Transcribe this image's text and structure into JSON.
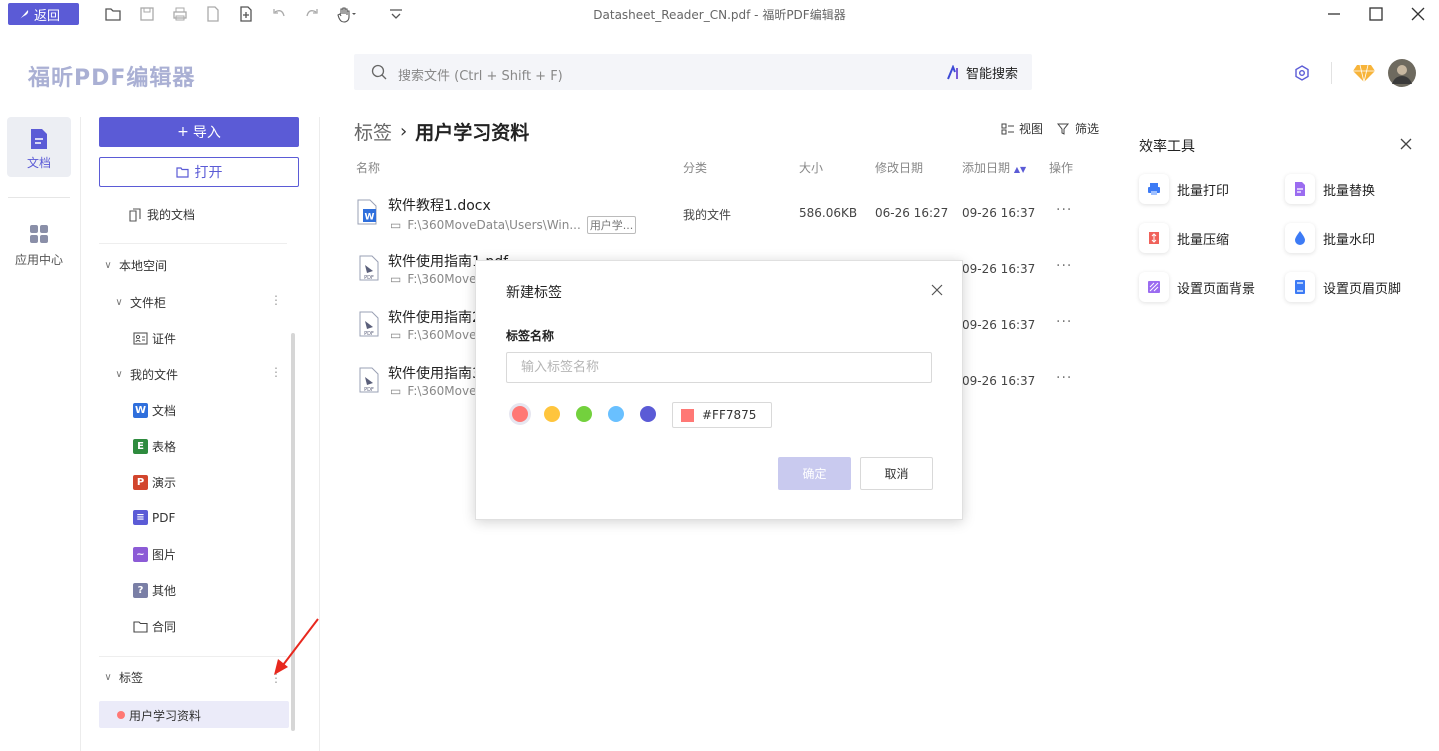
{
  "titlebar": {
    "back_label": "返回",
    "window_title": "Datasheet_Reader_CN.pdf - 福昕PDF编辑器",
    "toolbar_icons": [
      "open-folder-icon",
      "save-icon",
      "print-icon",
      "page-icon",
      "new-file-icon",
      "undo-icon",
      "redo-icon",
      "hand-tool-icon",
      "dropdown-icon"
    ]
  },
  "header": {
    "logo": "福昕PDF编辑器",
    "search_placeholder": "搜索文件 (Ctrl + Shift + F)",
    "ai_search_label": "智能搜索"
  },
  "rail": {
    "documents_label": "文档",
    "apps_label": "应用中心"
  },
  "sidebar": {
    "import_label": "导入",
    "open_label": "打开",
    "my_docs_label": "我的文档",
    "local_space_label": "本地空间",
    "cabinet_label": "文件柜",
    "certificate_label": "证件",
    "my_files_label": "我的文件",
    "file_types": [
      {
        "label": "文档",
        "color": "#2f6fdc",
        "glyph": "W"
      },
      {
        "label": "表格",
        "color": "#2e8b3e",
        "glyph": "E"
      },
      {
        "label": "演示",
        "color": "#d2452d",
        "glyph": "P"
      },
      {
        "label": "PDF",
        "color": "#5b5bd6",
        "glyph": "≡"
      },
      {
        "label": "图片",
        "color": "#8c5bd6",
        "glyph": "~"
      },
      {
        "label": "其他",
        "color": "#7a7fa6",
        "glyph": "?"
      },
      {
        "label": "合同",
        "color": "",
        "glyph": ""
      }
    ],
    "tags_label": "标签",
    "tag_items": [
      {
        "label": "用户学习资料",
        "color": "#FF7875"
      }
    ]
  },
  "main": {
    "breadcrumb_root": "标签",
    "breadcrumb_current": "用户学习资料",
    "view_label": "视图",
    "filter_label": "筛选",
    "columns": [
      "名称",
      "分类",
      "大小",
      "修改日期",
      "添加日期",
      "操作"
    ],
    "rows": [
      {
        "name": "软件教程1.docx",
        "path": "F:\\360MoveData\\Users\\Win...",
        "tag": "用户学...",
        "category": "我的文件",
        "size": "586.06KB",
        "modified": "06-26 16:27",
        "added": "09-26 16:37",
        "type": "word"
      },
      {
        "name": "软件使用指南1.pdf",
        "path": "F:\\360Move",
        "tag": "",
        "category": "",
        "size": "",
        "modified": "",
        "added": "09-26 16:37",
        "type": "pdf"
      },
      {
        "name": "软件使用指南2",
        "path": "F:\\360Move",
        "tag": "",
        "category": "",
        "size": "",
        "modified": "",
        "added": "09-26 16:37",
        "type": "pdf"
      },
      {
        "name": "软件使用指南3",
        "path": "F:\\360Move",
        "tag": "",
        "category": "",
        "size": "",
        "modified": "",
        "added": "09-26 16:37",
        "type": "pdf"
      }
    ],
    "more_glyph": "···"
  },
  "tools": {
    "title": "效率工具",
    "items": [
      {
        "label": "批量打印",
        "icon": "batch-print-icon",
        "color": "#3d7bf5"
      },
      {
        "label": "批量替换",
        "icon": "batch-replace-icon",
        "color": "#9b6cf0"
      },
      {
        "label": "批量压缩",
        "icon": "batch-compress-icon",
        "color": "#f0625a"
      },
      {
        "label": "批量水印",
        "icon": "batch-watermark-icon",
        "color": "#3d7bf5"
      },
      {
        "label": "设置页面背景",
        "icon": "page-background-icon",
        "color": "#9b6cf0"
      },
      {
        "label": "设置页眉页脚",
        "icon": "header-footer-icon",
        "color": "#3d7bf5"
      }
    ]
  },
  "dialog": {
    "title": "新建标签",
    "name_label": "标签名称",
    "name_placeholder": "输入标签名称",
    "name_value": "",
    "colors": [
      "#FF7875",
      "#FFC53D",
      "#73D13D",
      "#69C0FF",
      "#5B5BD6"
    ],
    "selected_color": "#FF7875",
    "color_value": "#FF7875",
    "ok_label": "确定",
    "cancel_label": "取消"
  }
}
